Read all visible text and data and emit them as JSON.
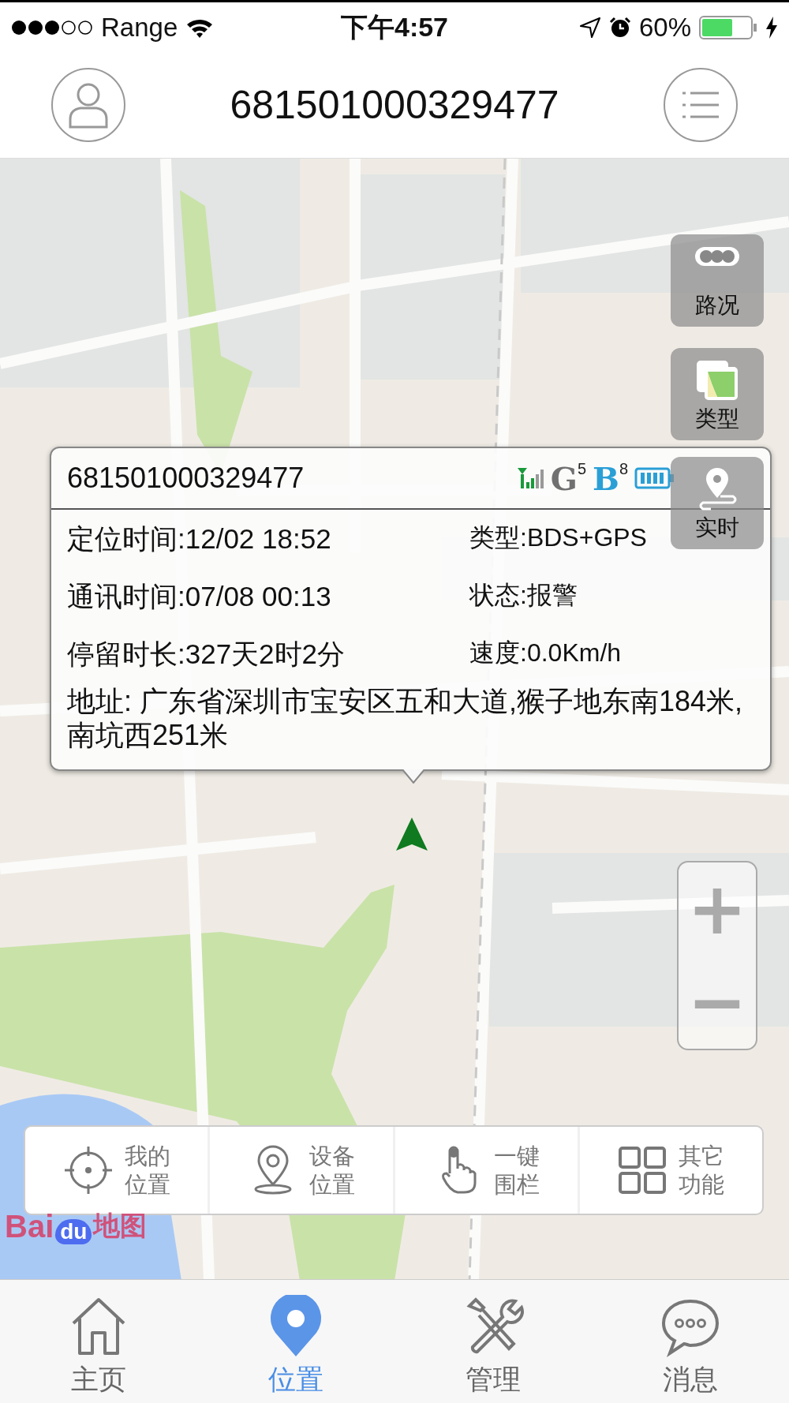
{
  "status_bar": {
    "carrier": "Range",
    "time": "下午4:57",
    "battery_text": "60%"
  },
  "header": {
    "title": "681501000329477"
  },
  "map": {
    "logo_text": "Bai",
    "logo_paw_text": "du",
    "logo_suffix": "地图",
    "side_buttons": [
      {
        "kind": "traffic",
        "label": "路况"
      },
      {
        "kind": "layers",
        "label": "类型"
      },
      {
        "kind": "realtime",
        "label": "实时"
      }
    ],
    "zoom": {
      "plus": "+",
      "minus": "−"
    }
  },
  "popup": {
    "device_id": "681501000329477",
    "badges": [
      {
        "letter": "G",
        "count": "5",
        "color": "#707070"
      },
      {
        "letter": "B",
        "count": "8",
        "color": "#2a9fd6"
      }
    ],
    "fields": [
      {
        "label": "定位时间:",
        "value": "12/02 18:52"
      },
      {
        "label": "类型:",
        "value": "BDS+GPS"
      },
      {
        "label": "通讯时间:",
        "value": "07/08 00:13"
      },
      {
        "label": "状态:",
        "value": "报警"
      },
      {
        "label": "停留时长:",
        "value": "327天2时2分"
      },
      {
        "label": "速度:",
        "value": "0.0Km/h"
      }
    ],
    "address": "地址: 广东省深圳市宝安区五和大道,猴子地东南184米,南坑西251米"
  },
  "toolbar": [
    {
      "kind": "my_location",
      "lines": [
        "我的",
        "位置"
      ]
    },
    {
      "kind": "device_location",
      "lines": [
        "设备",
        "位置"
      ]
    },
    {
      "kind": "fence",
      "lines": [
        "一键",
        "围栏"
      ]
    },
    {
      "kind": "more",
      "lines": [
        "其它",
        "功能"
      ]
    }
  ],
  "tabs": [
    {
      "kind": "home",
      "label": "主页",
      "selected": false
    },
    {
      "kind": "location",
      "label": "位置",
      "selected": true
    },
    {
      "kind": "manage",
      "label": "管理",
      "selected": false
    },
    {
      "kind": "messages",
      "label": "消息",
      "selected": false
    }
  ]
}
